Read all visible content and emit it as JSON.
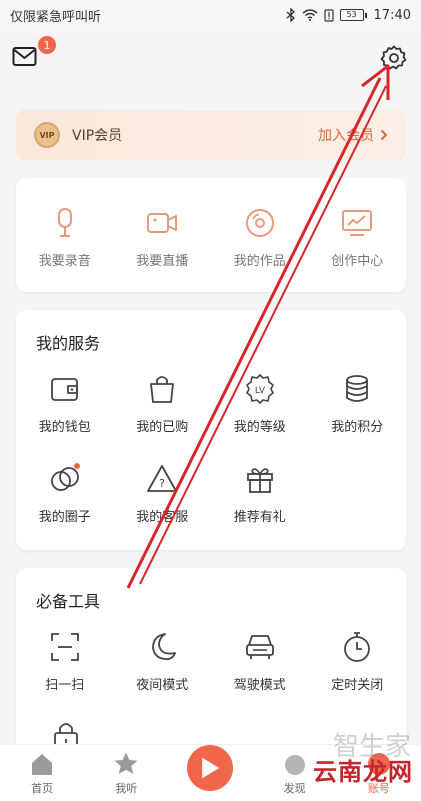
{
  "status": {
    "carrier": "仅限紧急呼叫",
    "app": "听",
    "battery": "53",
    "time": "17:40"
  },
  "top": {
    "mail_badge": "1"
  },
  "vip": {
    "badge": "VIP",
    "title": "VIP会员",
    "join": "加入会员"
  },
  "quick": [
    {
      "label": "我要录音",
      "icon": "microphone-icon"
    },
    {
      "label": "我要直播",
      "icon": "video-camera-icon"
    },
    {
      "label": "我的作品",
      "icon": "disc-icon"
    },
    {
      "label": "创作中心",
      "icon": "monitor-chart-icon"
    }
  ],
  "services": {
    "title": "我的服务",
    "items": [
      {
        "label": "我的钱包",
        "icon": "wallet-icon"
      },
      {
        "label": "我的已购",
        "icon": "shopping-bag-icon"
      },
      {
        "label": "我的等级",
        "icon": "level-badge-icon",
        "badge": "LV"
      },
      {
        "label": "我的积分",
        "icon": "coins-icon"
      },
      {
        "label": "我的圈子",
        "icon": "circles-icon"
      },
      {
        "label": "我的客服",
        "icon": "help-triangle-icon"
      },
      {
        "label": "推荐有礼",
        "icon": "gift-icon"
      }
    ]
  },
  "tools": {
    "title": "必备工具",
    "items": [
      {
        "label": "扫一扫",
        "icon": "scan-icon"
      },
      {
        "label": "夜间模式",
        "icon": "moon-icon"
      },
      {
        "label": "驾驶模式",
        "icon": "car-icon"
      },
      {
        "label": "定时关闭",
        "icon": "timer-icon"
      }
    ]
  },
  "tabs": [
    {
      "label": "首页",
      "icon": "home-icon"
    },
    {
      "label": "我听",
      "icon": "star-icon"
    },
    {
      "label": "",
      "icon": "play-icon"
    },
    {
      "label": "发现",
      "icon": "discover-icon"
    },
    {
      "label": "账号",
      "icon": "account-icon"
    }
  ],
  "watermark": "云南龙网",
  "colors": {
    "accent": "#f0664a",
    "icon_stroke": "#555555",
    "quick_icon": "#e39a7d"
  }
}
